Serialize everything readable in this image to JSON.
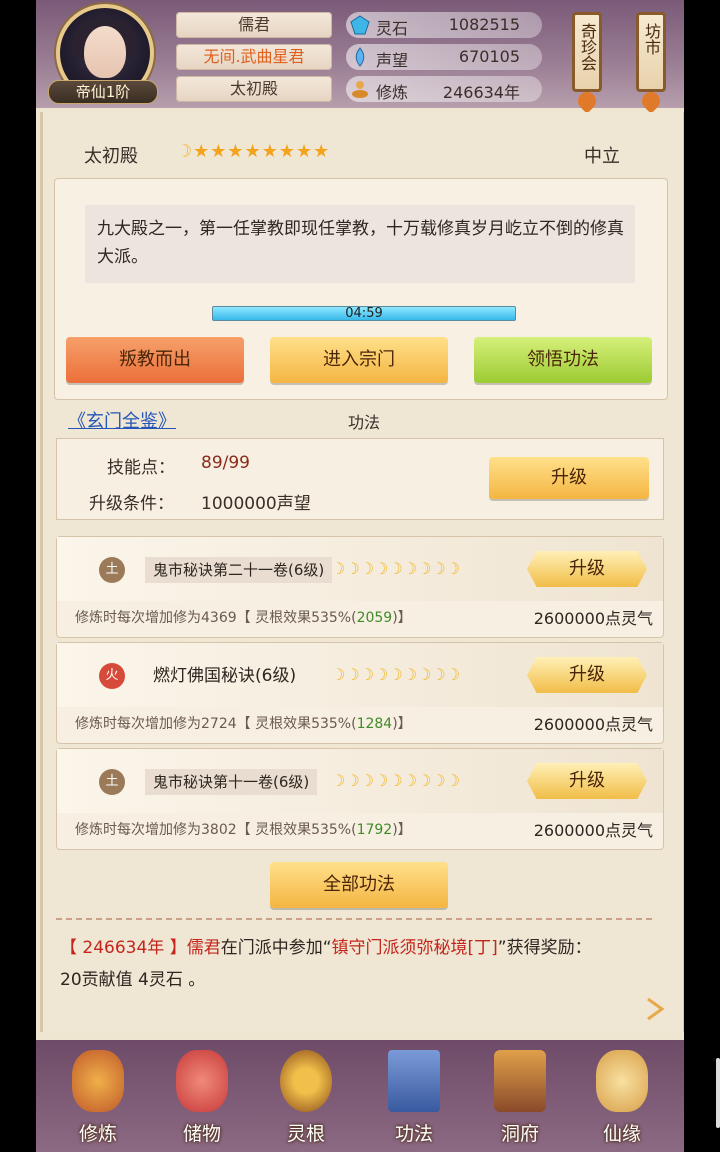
{
  "player": {
    "rank": "帝仙1阶",
    "name": "儒君",
    "title": "无间.武曲星君",
    "sect": "太初殿"
  },
  "stats": [
    {
      "icon": "spirit-stone-icon",
      "label": "灵石",
      "value": "1082515"
    },
    {
      "icon": "prestige-icon",
      "label": "声望",
      "value": "670105"
    },
    {
      "icon": "cultivation-icon",
      "label": "修炼",
      "value": "246634年"
    }
  ],
  "side_buttons": [
    {
      "label": "奇珍会"
    },
    {
      "label": "坊市"
    }
  ],
  "sect_panel": {
    "name": "太初殿",
    "stars": "★★★★★★★★",
    "stance": "中立",
    "description": "九大殿之一，第一任掌教即现任掌教，十万载修真岁月屹立不倒的修真大派。",
    "timer": "04:59",
    "buttons": {
      "leave": "叛教而出",
      "enter": "进入宗门",
      "learn": "领悟功法"
    }
  },
  "gongfa": {
    "link": "《玄门全鉴》",
    "section_label": "功法",
    "skill_points_label": "技能点：",
    "skill_points_value": "89/99",
    "condition_label": "升级条件：",
    "condition_value": "1000000声望",
    "upgrade_label": "升级"
  },
  "techniques": [
    {
      "element": "土",
      "element_color": "#9b7a5a",
      "name": "鬼市秘诀第二十一卷(6级)",
      "moons": "☽☽☽☽☽☽☽☽☽",
      "upgrade": "升级",
      "desc_pre": "修炼时每次增加修为4369【 灵根效果535%(",
      "desc_green": "2059",
      "desc_post": ")】",
      "cost": "2600000点灵气"
    },
    {
      "element": "火",
      "element_color": "#d64a3a",
      "name": "燃灯佛国秘诀(6级)",
      "moons": "☽☽☽☽☽☽☽☽☽",
      "upgrade": "升级",
      "desc_pre": "修炼时每次增加修为2724【 灵根效果535%(",
      "desc_green": "1284",
      "desc_post": ")】",
      "cost": "2600000点灵气"
    },
    {
      "element": "土",
      "element_color": "#9b7a5a",
      "name": "鬼市秘诀第十一卷(6级)",
      "moons": "☽☽☽☽☽☽☽☽☽",
      "upgrade": "升级",
      "desc_pre": "修炼时每次增加修为3802【 灵根效果535%(",
      "desc_green": "1792",
      "desc_post": ")】",
      "cost": "2600000点灵气"
    }
  ],
  "all_techniques_label": "全部功法",
  "log": {
    "year": "【 246634年 】",
    "name": "儒君",
    "mid": "在门派中参加“",
    "event": "镇守门派须弥秘境[丁]",
    "end": "”获得奖励：",
    "reward": "20贡献值 4灵石 。"
  },
  "nav": [
    {
      "label": "修炼",
      "icon": "cultivate-icon",
      "color": "#c05a2a"
    },
    {
      "label": "储物",
      "icon": "storage-bag-icon",
      "color": "#d84a4a"
    },
    {
      "label": "灵根",
      "icon": "spirit-root-icon",
      "color": "#b8742a"
    },
    {
      "label": "功法",
      "icon": "scripture-book-icon",
      "color": "#4a6ab0"
    },
    {
      "label": "洞府",
      "icon": "cave-dwelling-icon",
      "color": "#c07a3a"
    },
    {
      "label": "仙缘",
      "icon": "immortal-fate-icon",
      "color": "#d8a04a"
    }
  ]
}
